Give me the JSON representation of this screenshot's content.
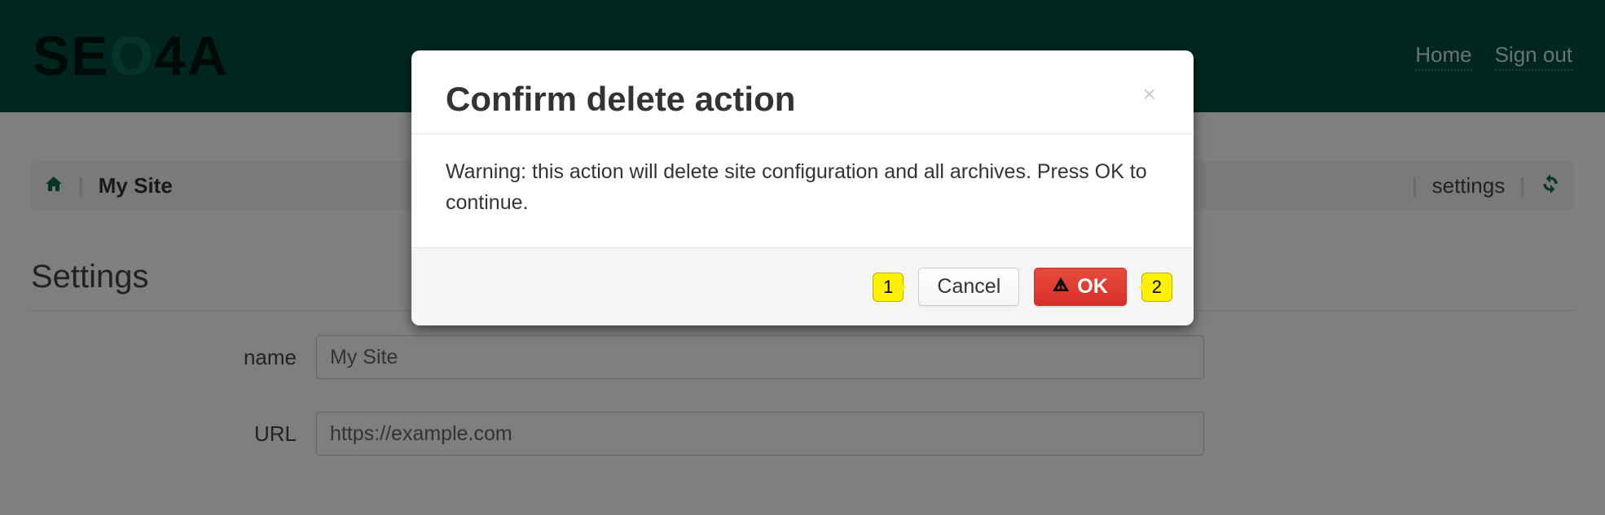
{
  "brand": {
    "part1": "SE",
    "part2": "O",
    "part3": "4A"
  },
  "nav": {
    "home": "Home",
    "signout": "Sign out"
  },
  "toolbar": {
    "sitename": "My Site",
    "settings": "settings"
  },
  "section": {
    "title": "Settings"
  },
  "form": {
    "name_label": "name",
    "name_value": "My Site",
    "url_label": "URL",
    "url_value": "https://example.com"
  },
  "modal": {
    "title": "Confirm delete action",
    "body": "Warning: this action will delete site configuration and all archives. Press OK to continue.",
    "cancel": "Cancel",
    "ok": "OK"
  },
  "markers": {
    "one": "1",
    "two": "2"
  }
}
